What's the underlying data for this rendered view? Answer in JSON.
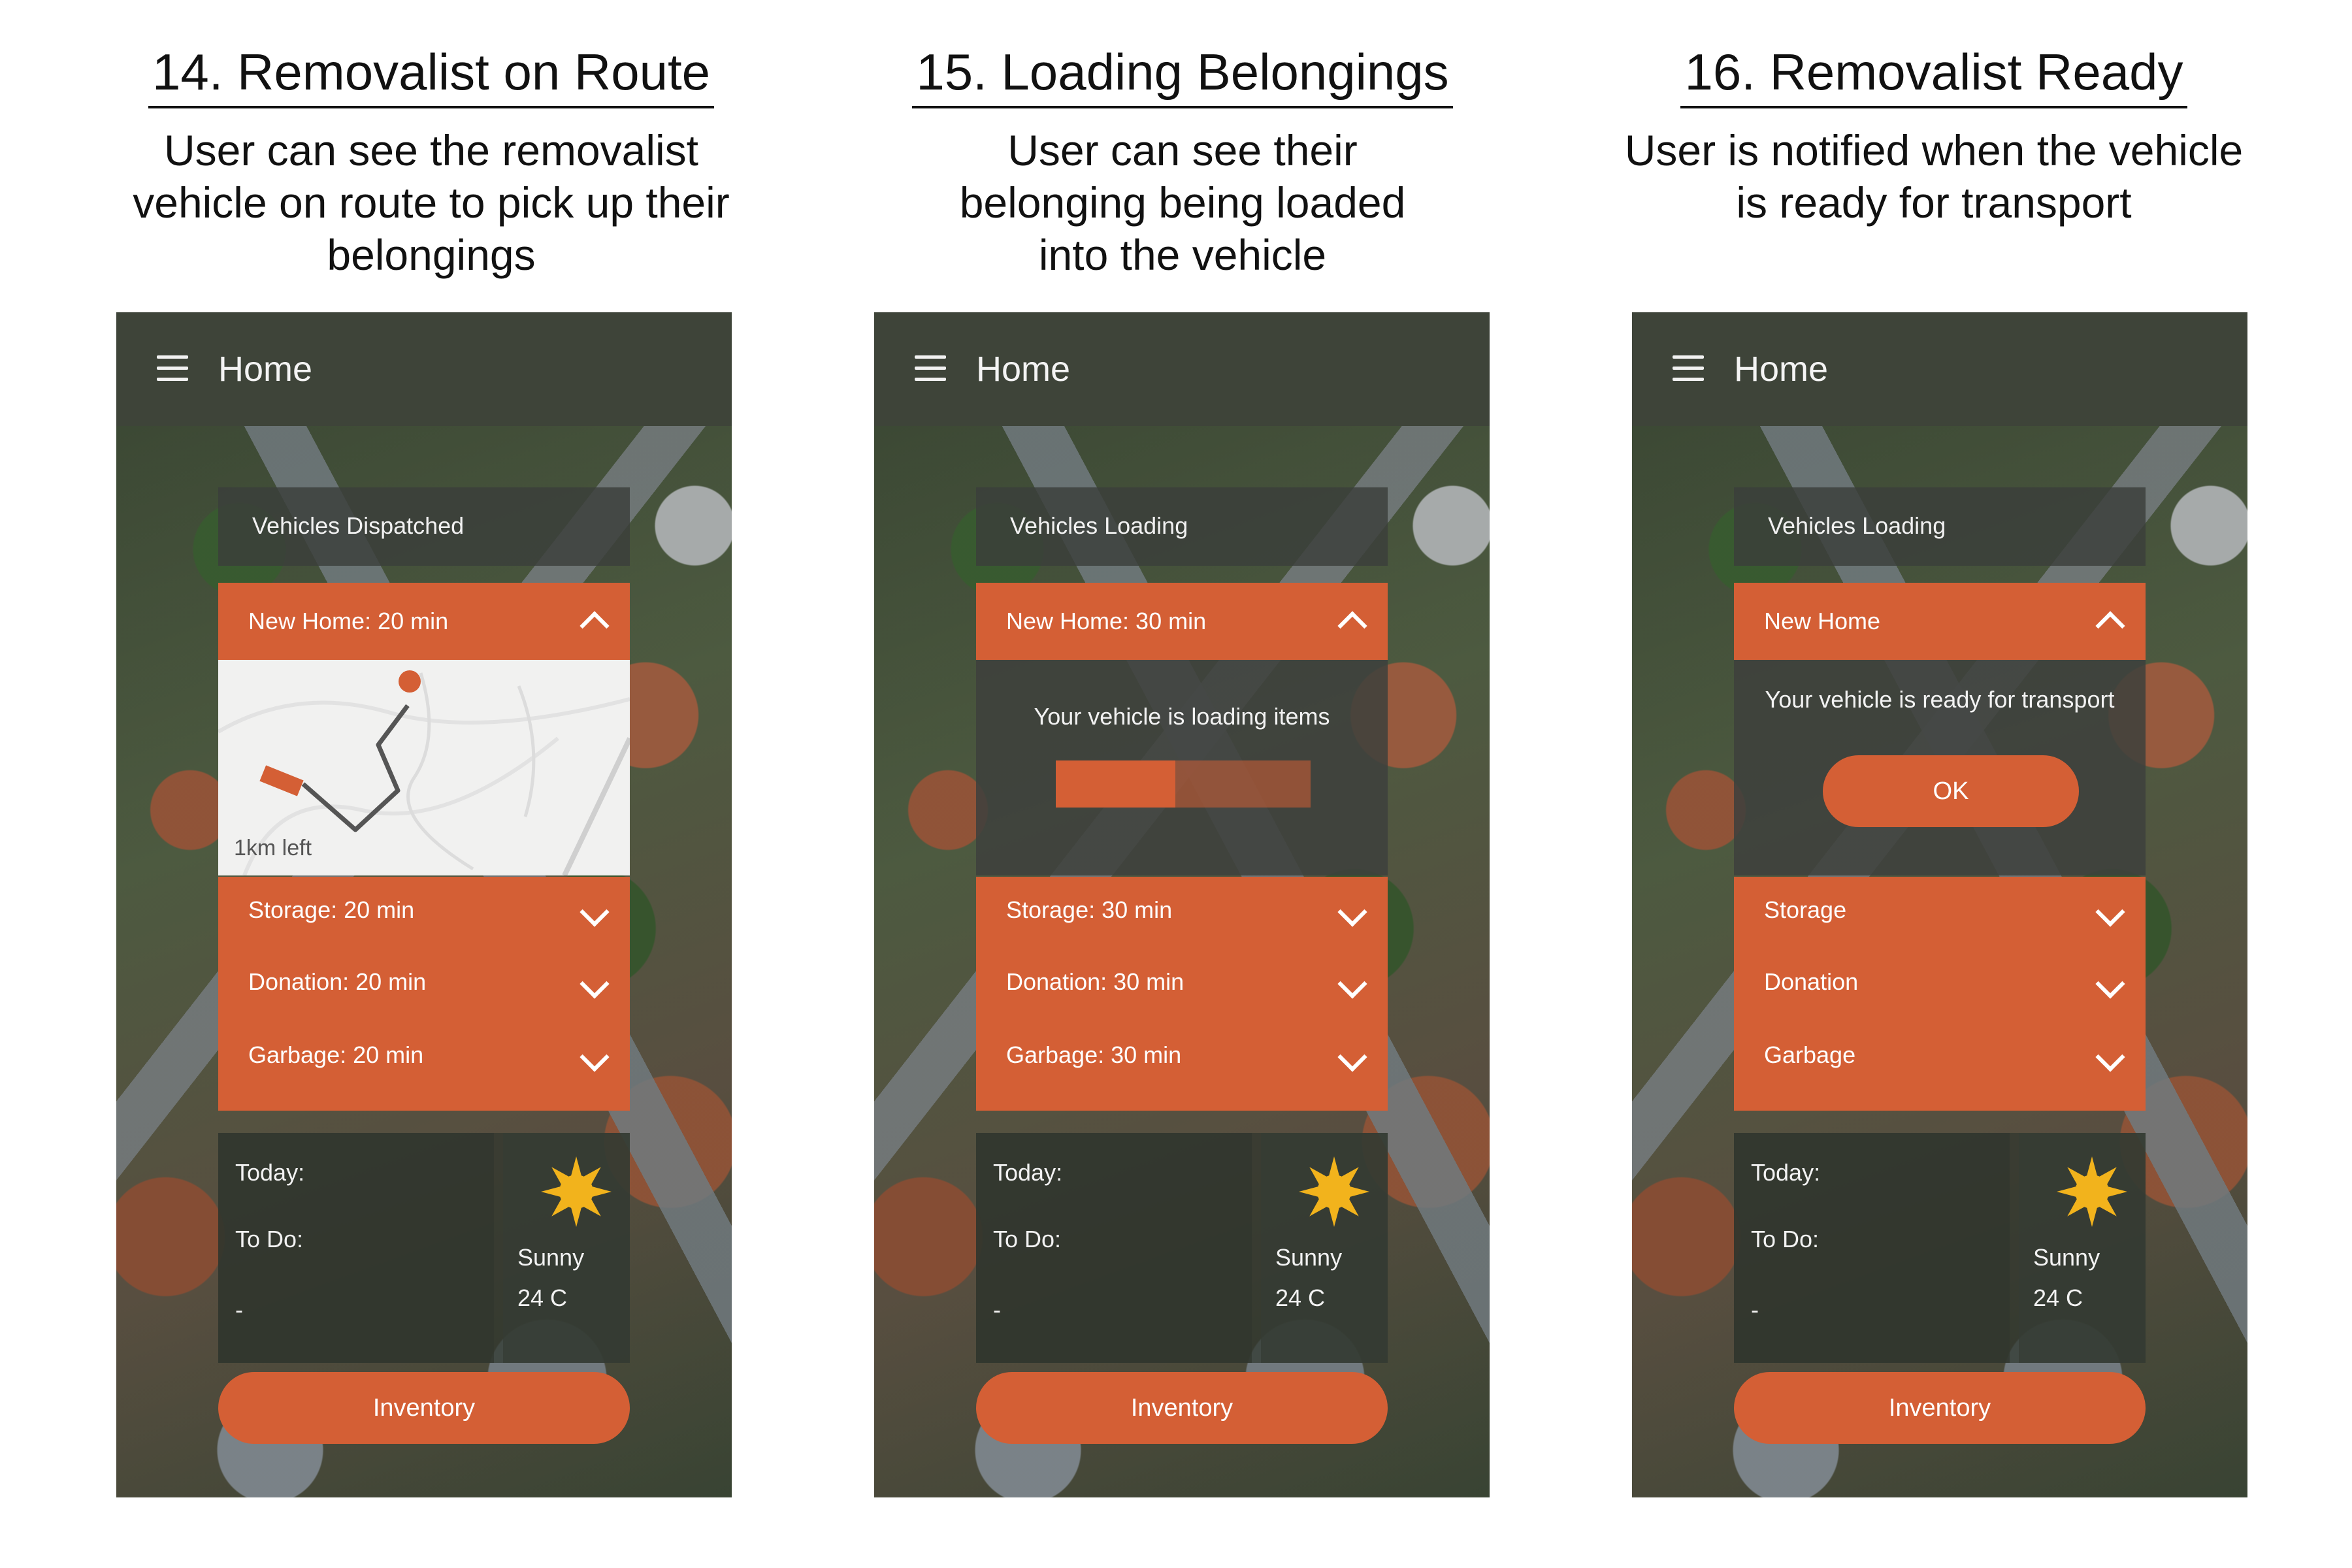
{
  "screens": [
    {
      "step_title": "14. Removalist on Route",
      "step_description": "User can see the removalist vehicle on route to pick up their belongings",
      "app_title": "Home",
      "status_header": "Vehicles Dispatched",
      "expanded_item": "New Home: 20 min",
      "map_distance": "1km left",
      "list_items": [
        "Storage: 20 min",
        "Donation: 20 min",
        "Garbage: 20 min"
      ],
      "today_label": "Today:",
      "todo_label": "To Do:",
      "todo_value": "-",
      "weather_condition": "Sunny",
      "temperature": "24 C",
      "inventory_button": "Inventory"
    },
    {
      "step_title": "15. Loading Belongings",
      "step_description": "User can see their belonging being loaded into the vehicle",
      "app_title": "Home",
      "status_header": "Vehicles Loading",
      "expanded_item": "New Home: 30 min",
      "loading_message": "Your vehicle is loading items",
      "loading_progress": 0.47,
      "list_items": [
        "Storage: 30 min",
        "Donation: 30 min",
        "Garbage: 30 min"
      ],
      "today_label": "Today:",
      "todo_label": "To Do:",
      "todo_value": "-",
      "weather_condition": "Sunny",
      "temperature": "24 C",
      "inventory_button": "Inventory"
    },
    {
      "step_title": "16. Removalist Ready",
      "step_description": "User is notified when the vehicle is ready for transport",
      "app_title": "Home",
      "status_header": "Vehicles Loading",
      "expanded_item": "New Home",
      "ready_message": "Your vehicle is ready for transport",
      "ok_button": "OK",
      "list_items": [
        "Storage",
        "Donation",
        "Garbage"
      ],
      "today_label": "Today:",
      "todo_label": "To Do:",
      "todo_value": "-",
      "weather_condition": "Sunny",
      "temperature": "24 C",
      "inventory_button": "Inventory"
    }
  ],
  "icons": [
    "menu-icon",
    "chevron-up-icon",
    "chevron-down-icon",
    "sun-icon",
    "map-pin-icon",
    "truck-icon"
  ],
  "colors": {
    "accent": "#d45f35",
    "topbar": "#3e4439",
    "text_light": "#f2f2f2"
  }
}
